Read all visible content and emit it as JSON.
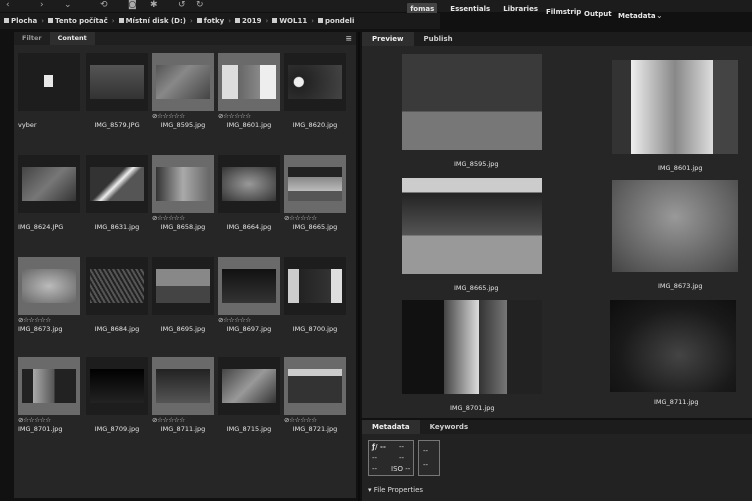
{
  "workspaces": [
    "fomas",
    "Essentials",
    "Libraries"
  ],
  "workspaces_more": {
    "filmstrip": "Filmstrip",
    "output": "Output",
    "metadata": "Metadata",
    "chevron": "⌄"
  },
  "breadcrumbs": [
    "Plocha",
    "Tento počítač",
    "Místní disk (D:)",
    "fotky",
    "2019",
    "WOL11",
    "pondeli"
  ],
  "left_tabs": {
    "filter": "Filter",
    "content": "Content"
  },
  "right_tabs": {
    "preview": "Preview",
    "publish": "Publish"
  },
  "meta_tabs": {
    "metadata": "Metadata",
    "keywords": "Keywords"
  },
  "star_row": "⊘☆☆☆☆☆",
  "thumbnails": [
    {
      "name": "vyber",
      "folder": true
    },
    {
      "name": "IMG_8579.JPG"
    },
    {
      "name": "IMG_8595.jpg",
      "selected": true,
      "stars": true
    },
    {
      "name": "IMG_8601.jpg",
      "selected": true,
      "stars": true
    },
    {
      "name": "IMG_8620.jpg"
    },
    {
      "name": "IMG_8624.JPG"
    },
    {
      "name": "IMG_8631.jpg"
    },
    {
      "name": "IMG_8658.jpg",
      "selected": true,
      "stars": true
    },
    {
      "name": "IMG_8664.jpg"
    },
    {
      "name": "IMG_8665.jpg",
      "selected": true,
      "stars": true
    },
    {
      "name": "IMG_8673.jpg",
      "selected": true,
      "stars": true
    },
    {
      "name": "IMG_8684.jpg"
    },
    {
      "name": "IMG_8695.jpg"
    },
    {
      "name": "IMG_8697.jpg",
      "selected": true,
      "stars": true
    },
    {
      "name": "IMG_8700.jpg"
    },
    {
      "name": "IMG_8701.jpg",
      "selected": true,
      "stars": true
    },
    {
      "name": "IMG_8709.jpg"
    },
    {
      "name": "IMG_8711.jpg",
      "selected": true,
      "stars": true
    },
    {
      "name": "IMG_8715.jpg"
    },
    {
      "name": "IMG_8721.jpg",
      "selected": true,
      "stars": true
    }
  ],
  "previews": [
    "IMG_8595.jpg",
    "IMG_8601.jpg",
    "IMG_8665.jpg",
    "IMG_8673.jpg",
    "IMG_8701.jpg",
    "IMG_8711.jpg"
  ],
  "metadata_box": {
    "aperture": "ƒ/ --",
    "shutter": "--",
    "v1": "--",
    "v2": "--",
    "v3": "--",
    "iso": "ISO --",
    "r1": "--",
    "r2": "--"
  },
  "file_properties": "▾ File Properties"
}
